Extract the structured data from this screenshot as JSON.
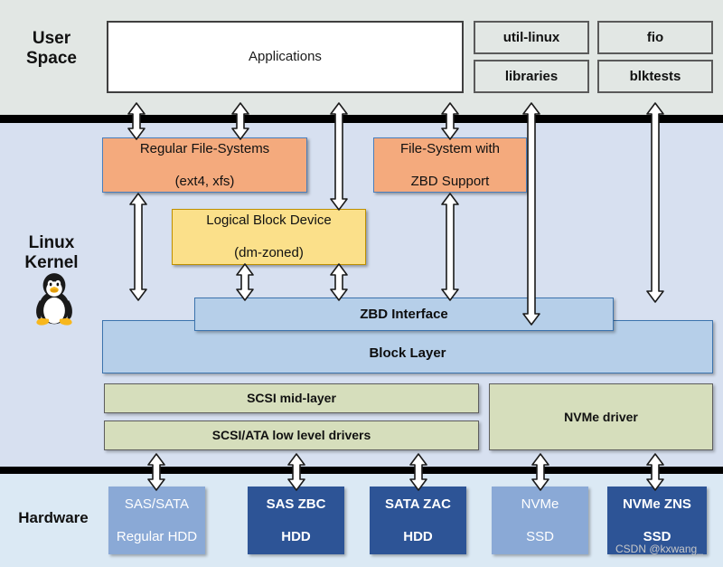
{
  "bands": {
    "user_space_label": "User\nSpace",
    "kernel_label": "Linux\nKernel",
    "hardware_label": "Hardware"
  },
  "user_space": {
    "applications": "Applications",
    "tools": [
      {
        "label": "util-linux"
      },
      {
        "label": "fio"
      },
      {
        "label": "libraries"
      },
      {
        "label": "blktests"
      }
    ]
  },
  "kernel": {
    "regular_fs_line1": "Regular File-Systems",
    "regular_fs_line2": "(ext4, xfs)",
    "zbd_fs_line1": "File-System with",
    "zbd_fs_line2": "ZBD Support",
    "logical_block_device_line1": "Logical Block Device",
    "logical_block_device_line2": "(dm-zoned)",
    "zbd_interface": "ZBD Interface",
    "block_layer": "Block Layer",
    "scsi_mid_layer": "SCSI mid-layer",
    "scsi_ata_low_level": "SCSI/ATA low level drivers",
    "nvme_driver": "NVMe driver"
  },
  "hardware": {
    "devices": [
      {
        "line1": "SAS/SATA",
        "line2": "Regular HDD",
        "zoned": false
      },
      {
        "line1": "SAS ZBC",
        "line2": "HDD",
        "zoned": true
      },
      {
        "line1": "SATA ZAC",
        "line2": "HDD",
        "zoned": true
      },
      {
        "line1": "NVMe",
        "line2": "SSD",
        "zoned": false
      },
      {
        "line1": "NVMe ZNS",
        "line2": "SSD",
        "zoned": true
      }
    ]
  },
  "watermark": "CSDN @kxwang_",
  "colors": {
    "user_space_bg": "#e2e7e4",
    "kernel_bg": "#d7e0f0",
    "hardware_bg": "#dbe9f4",
    "separator": "#000000",
    "filesystem_orange": "#f4aa7d",
    "logical_block_yellow": "#fbe08a",
    "block_layer_blue": "#b6cfe9",
    "driver_green": "#d6debc",
    "device_regular": "#8aa9d6",
    "device_zoned": "#2d5496"
  }
}
